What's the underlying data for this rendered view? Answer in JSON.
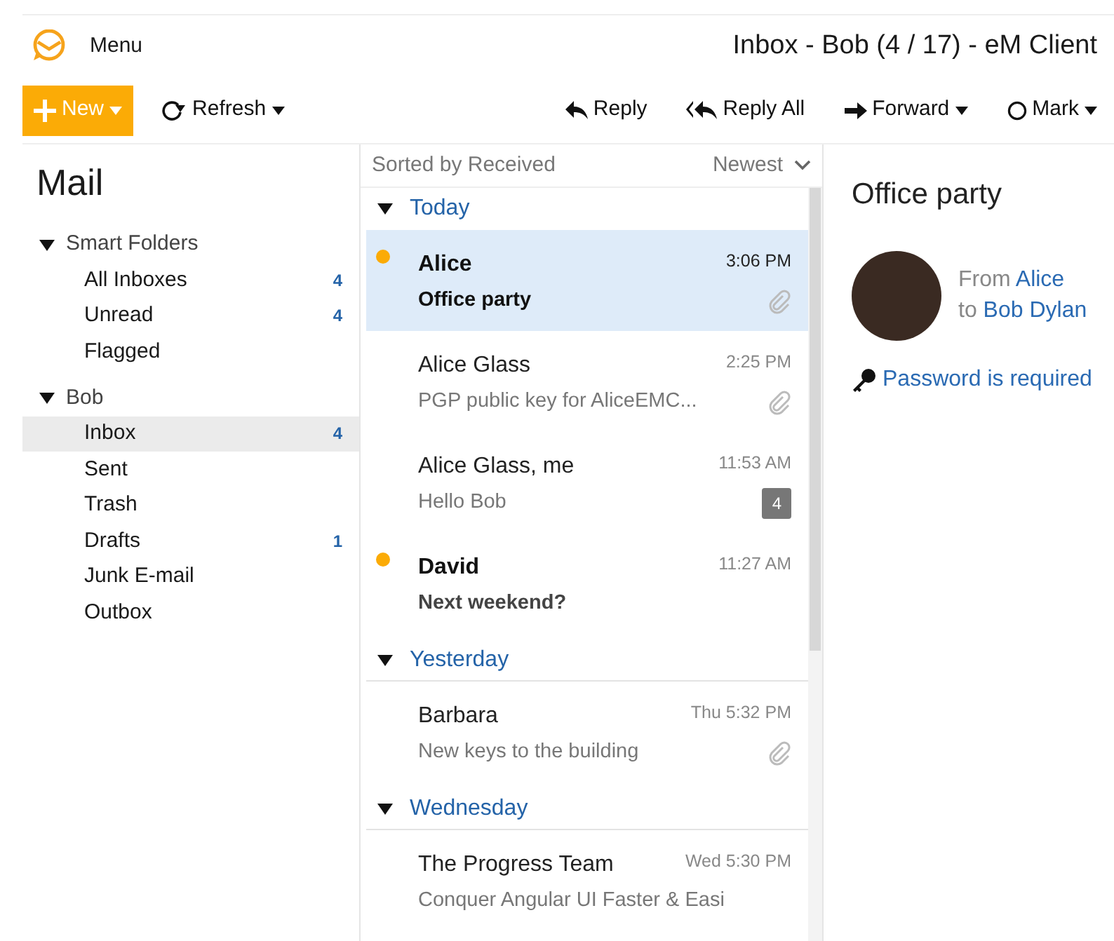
{
  "app": {
    "menu_label": "Menu",
    "title": "Inbox - Bob (4 / 17) - eM Client"
  },
  "toolbar": {
    "left": [
      {
        "kind": "new",
        "label": "New",
        "dropdown": true
      },
      {
        "kind": "refresh",
        "label": "Refresh",
        "dropdown": true
      }
    ],
    "right": [
      {
        "kind": "reply",
        "label": "Reply",
        "dropdown": false
      },
      {
        "kind": "reply_all",
        "label": "Reply All",
        "dropdown": false
      },
      {
        "kind": "forward",
        "label": "Forward",
        "dropdown": true
      },
      {
        "kind": "mark",
        "label": "Mark",
        "dropdown": true
      }
    ]
  },
  "sidebar": {
    "title": "Mail",
    "groups": [
      {
        "label": "Smart Folders",
        "expanded": true,
        "children": [
          {
            "label": "All Inboxes",
            "count": "4",
            "selected": false
          },
          {
            "label": "Unread",
            "count": "4",
            "selected": false
          },
          {
            "label": "Flagged",
            "selected": false
          }
        ]
      },
      {
        "label": "Bob",
        "expanded": true,
        "children": [
          {
            "label": "Inbox",
            "count": "4",
            "selected": true
          },
          {
            "label": "Sent",
            "selected": false
          },
          {
            "label": "Trash",
            "selected": false
          },
          {
            "label": "Drafts",
            "count": "1",
            "selected": false
          },
          {
            "label": "Junk E-mail",
            "selected": false
          },
          {
            "label": "Outbox",
            "selected": false
          }
        ]
      }
    ]
  },
  "message_list": {
    "sort_label": "Sorted by Received",
    "order_label": "Newest",
    "groups": [
      {
        "label": "Today",
        "expanded": true,
        "messages": [
          {
            "sender": "Alice",
            "subject": "Office party",
            "time": "3:06 PM",
            "unread": true,
            "selected": true,
            "attachment": true
          },
          {
            "sender": "Alice Glass",
            "subject": "PGP public key for AliceEMC...",
            "time": "2:25 PM",
            "unread": false,
            "selected": false,
            "attachment": true
          },
          {
            "sender": "Alice Glass, me",
            "subject": "Hello Bob",
            "time": "11:53 AM",
            "unread": false,
            "selected": false,
            "attachment": false,
            "thread_count": "4"
          },
          {
            "sender": "David",
            "subject": "Next weekend?",
            "time": "11:27 AM",
            "unread": true,
            "selected": false,
            "attachment": false
          }
        ]
      },
      {
        "label": "Yesterday",
        "expanded": true,
        "messages": [
          {
            "sender": "Barbara",
            "subject": "New keys to the building",
            "time": "Thu 5:32 PM",
            "unread": false,
            "selected": false,
            "attachment": true
          }
        ]
      },
      {
        "label": "Wednesday",
        "expanded": true,
        "messages": [
          {
            "sender": "The Progress Team",
            "subject": "Conquer Angular UI Faster & Easi",
            "time": "Wed 5:30 PM",
            "unread": false,
            "selected": false,
            "attachment": false
          }
        ]
      }
    ]
  },
  "reading_pane": {
    "subject": "Office party",
    "from_label": "From",
    "from": "Alice",
    "to_label": "to",
    "to": "Bob Dylan",
    "notice": "Password is required"
  }
}
